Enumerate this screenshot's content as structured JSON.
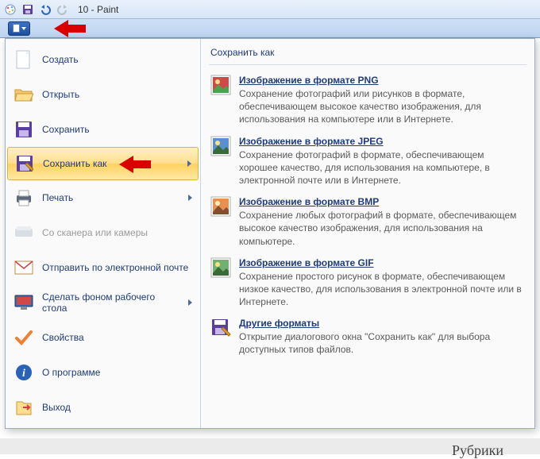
{
  "titlebar": {
    "title": "10 - Paint"
  },
  "leftMenu": {
    "create": "Создать",
    "open": "Открыть",
    "save": "Сохранить",
    "saveAs": "Сохранить как",
    "print": "Печать",
    "scanner": "Со сканера или камеры",
    "email": "Отправить по электронной почте",
    "wallpaper": "Сделать фоном рабочего стола",
    "properties": "Свойства",
    "about": "О программе",
    "exit": "Выход"
  },
  "rightPanel": {
    "header": "Сохранить как",
    "formats": [
      {
        "title": "Изображение в формате PNG",
        "desc": "Сохранение фотографий или рисунков в формате, обеспечивающем высокое качество изображения, для использования на компьютере или в Интернете."
      },
      {
        "title": "Изображение в формате JPEG",
        "desc": "Сохранение фотографий в формате, обеспечивающем хорошее качество, для использования на компьютере, в электронной почте или в Интернете."
      },
      {
        "title": "Изображение в формате BMP",
        "desc": "Сохранение любых фотографий в формате, обеспечивающем высокое качество изображения, для использования на компьютере."
      },
      {
        "title": "Изображение в формате GIF",
        "desc": "Сохранение простого рисунок в формате, обеспечивающем низкое качество, для использования в электронной почте или в Интернете."
      },
      {
        "title": "Другие форматы",
        "desc": "Открытие диалогового окна \"Сохранить как\" для выбора доступных типов файлов."
      }
    ]
  },
  "footer": {
    "rubriki": "Рубрики"
  }
}
